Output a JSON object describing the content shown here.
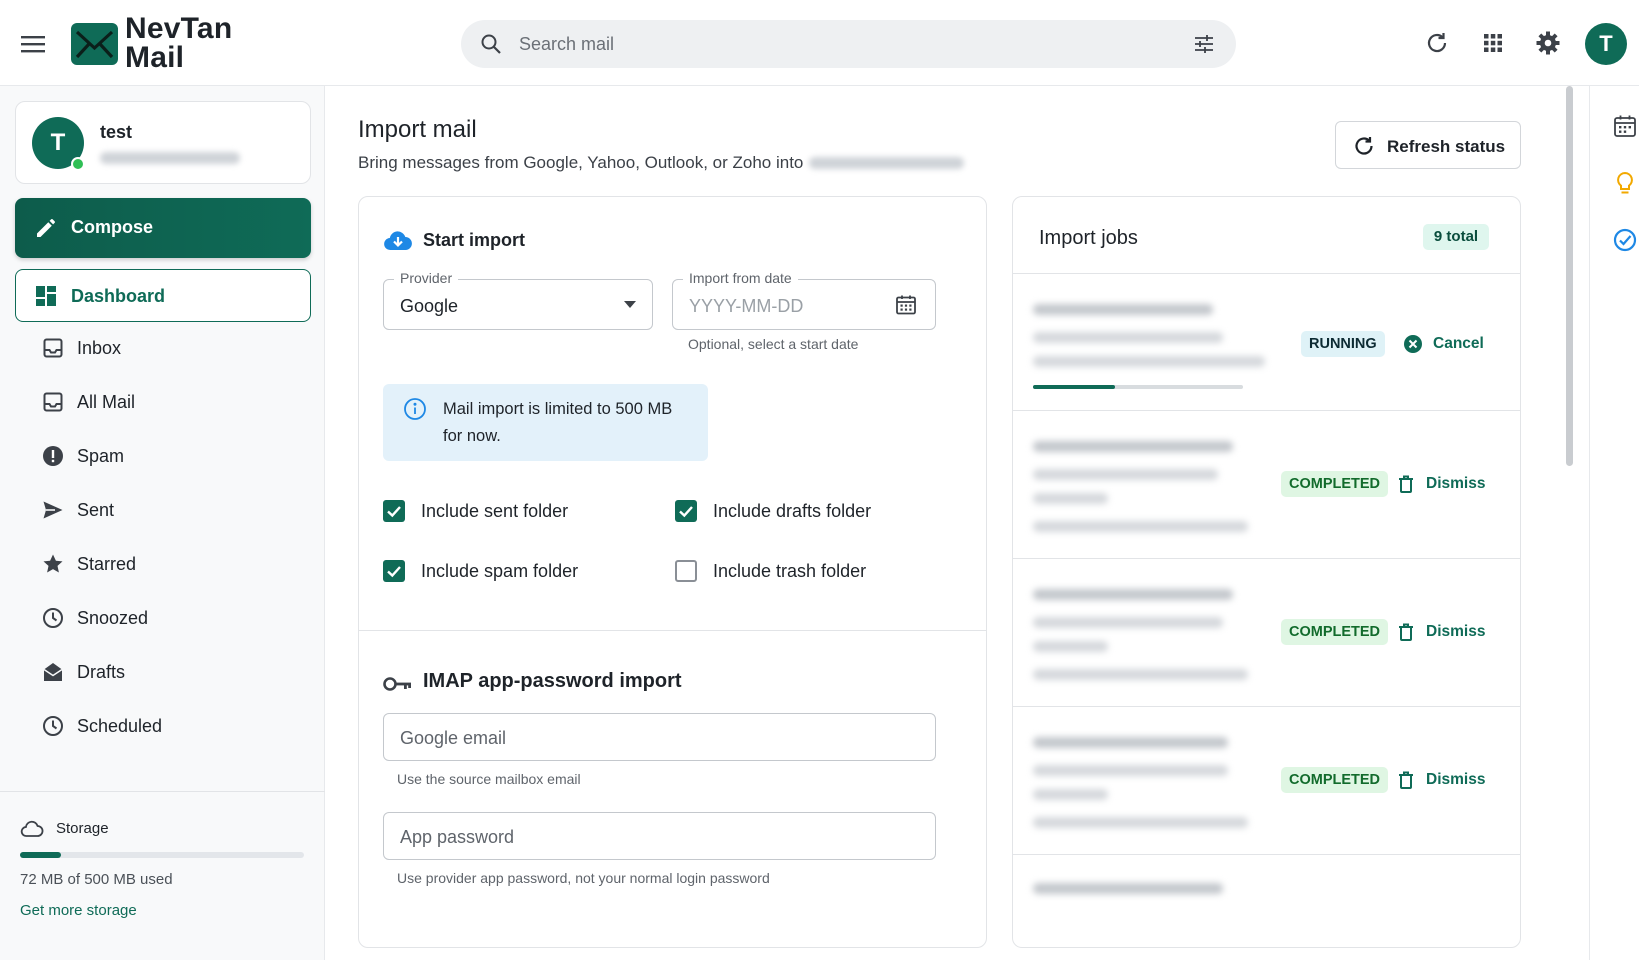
{
  "app": {
    "brand_line1": "NevTan",
    "brand_line2": "Mail",
    "avatar_initial": "T"
  },
  "search": {
    "placeholder": "Search mail"
  },
  "account": {
    "name": "test",
    "initial": "T",
    "email_blurred": true
  },
  "sidebar": {
    "compose_label": "Compose",
    "dashboard_label": "Dashboard",
    "items": [
      {
        "label": "Inbox",
        "icon": "inbox-icon"
      },
      {
        "label": "All Mail",
        "icon": "all-mail-icon"
      },
      {
        "label": "Spam",
        "icon": "spam-icon"
      },
      {
        "label": "Sent",
        "icon": "sent-icon"
      },
      {
        "label": "Starred",
        "icon": "star-icon"
      },
      {
        "label": "Snoozed",
        "icon": "clock-icon"
      },
      {
        "label": "Drafts",
        "icon": "drafts-icon"
      },
      {
        "label": "Scheduled",
        "icon": "clock-icon"
      }
    ],
    "storage": {
      "title": "Storage",
      "used_text": "72 MB of 500 MB used",
      "fraction_used": 0.144,
      "link": "Get more storage"
    }
  },
  "page": {
    "title": "Import mail",
    "subtitle": "Bring messages from Google, Yahoo, Outlook, or Zoho into",
    "refresh_label": "Refresh status"
  },
  "start_import": {
    "title": "Start import",
    "provider_label": "Provider",
    "provider_value": "Google",
    "date_label": "Import from date",
    "date_placeholder": "YYYY-MM-DD",
    "date_helper": "Optional, select a start date",
    "info": "Mail import is limited to 500 MB for now.",
    "options": [
      {
        "label": "Include sent folder",
        "checked": true
      },
      {
        "label": "Include drafts folder",
        "checked": true
      },
      {
        "label": "Include spam folder",
        "checked": true
      },
      {
        "label": "Include trash folder",
        "checked": false
      }
    ]
  },
  "imap": {
    "title": "IMAP app-password import",
    "email_placeholder": "Google email",
    "email_helper": "Use the source mailbox email",
    "password_placeholder": "App password",
    "password_helper": "Use provider app password, not your normal login password"
  },
  "jobs": {
    "title": "Import jobs",
    "total_label": "9 total",
    "items": [
      {
        "status": "RUNNING",
        "action": "Cancel",
        "progress": 0.39
      },
      {
        "status": "COMPLETED",
        "action": "Dismiss"
      },
      {
        "status": "COMPLETED",
        "action": "Dismiss"
      },
      {
        "status": "COMPLETED",
        "action": "Dismiss"
      }
    ]
  },
  "colors": {
    "accent": "#0f6b57",
    "running_bg": "#dff2f7",
    "completed_bg": "#dff6e3",
    "completed_text": "#126b2c",
    "info_bg": "#e3f1fa"
  }
}
